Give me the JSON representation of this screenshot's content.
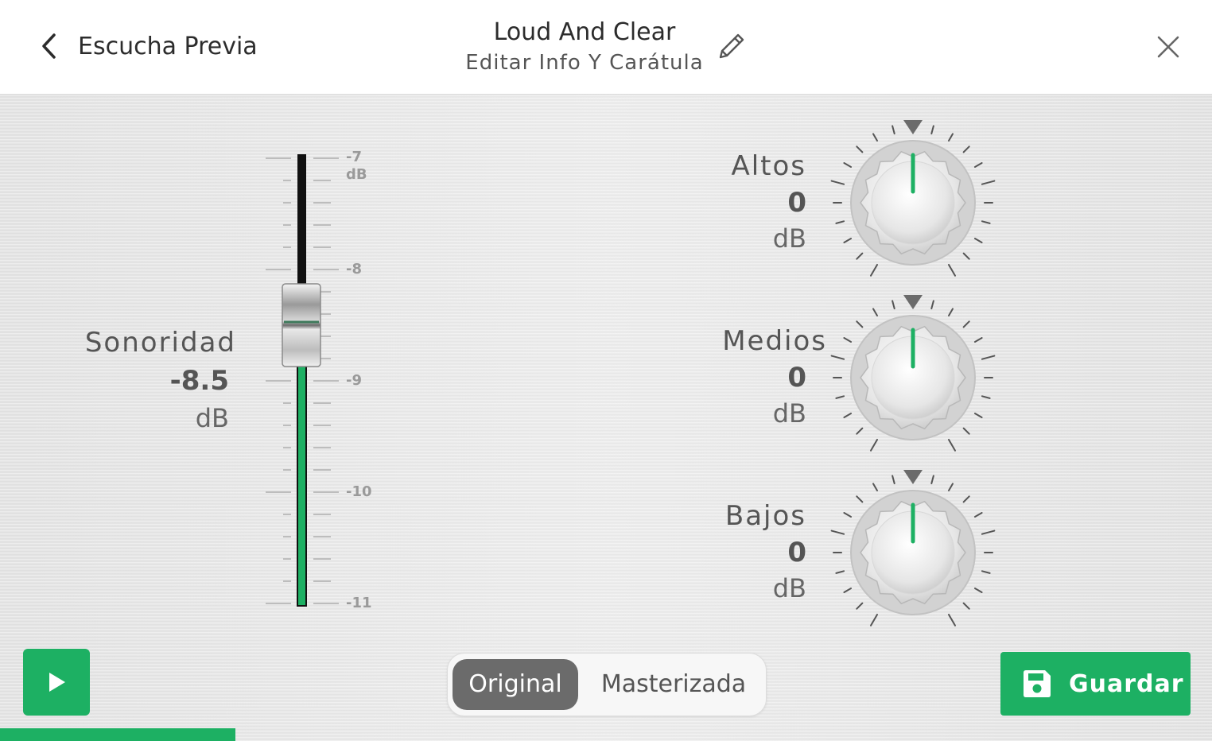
{
  "header": {
    "back_label": "Escucha Previa",
    "title": "Loud And Clear",
    "subtitle": "Editar Info Y Carátula"
  },
  "loudness": {
    "label": "Sonoridad",
    "value": "-8.5",
    "unit": "dB",
    "level": -8.5,
    "scale_min": -11,
    "scale_max": -7,
    "ticks": [
      "-7",
      "-8",
      "-9",
      "-10",
      "-11"
    ],
    "top_unit": "dB"
  },
  "knobs": [
    {
      "label": "Altos",
      "value": "0",
      "unit": "dB"
    },
    {
      "label": "Medios",
      "value": "0",
      "unit": "dB"
    },
    {
      "label": "Bajos",
      "value": "0",
      "unit": "dB"
    }
  ],
  "toggle": {
    "active": "Original",
    "inactive": "Masterizada"
  },
  "save_label": "Guardar",
  "colors": {
    "accent": "#1db063",
    "toggle_active": "#6b6b6b"
  },
  "icons": [
    "chevron-left-icon",
    "pencil-icon",
    "close-icon",
    "play-icon",
    "save-icon"
  ]
}
